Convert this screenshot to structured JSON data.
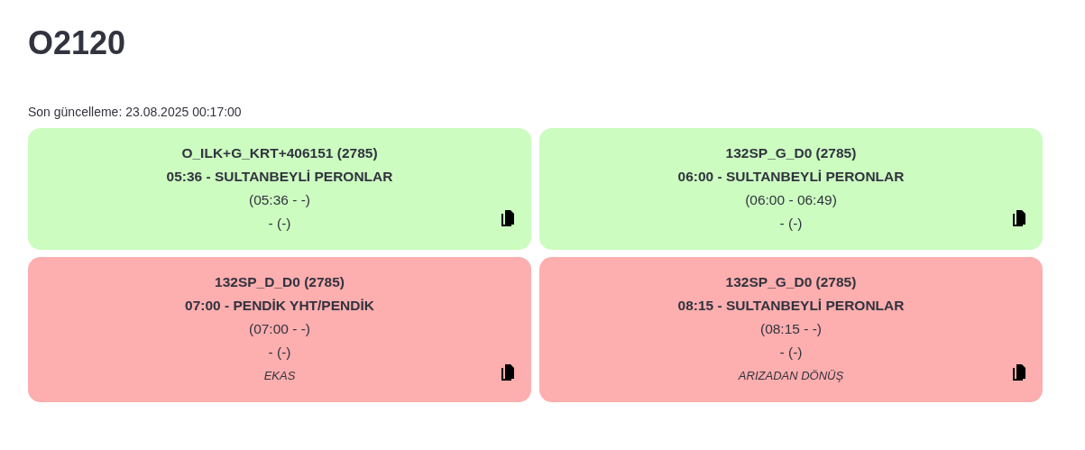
{
  "title": "O2120",
  "last_update": "Son güncelleme: 23.08.2025 00:17:00",
  "cards": [
    {
      "color": "#ccfcc0",
      "code": "O_ILK+G_KRT+406151 (2785)",
      "route": "05:36 - SULTANBEYLİ PERONLAR",
      "times": "(05:36 - -)",
      "extra": "- (-)"
    },
    {
      "color": "#ccfcc0",
      "code": "132SP_G_D0 (2785)",
      "route": "06:00 - SULTANBEYLİ PERONLAR",
      "times": "(06:00 - 06:49)",
      "extra": "- (-)"
    },
    {
      "color": "#fdaeae",
      "code": "132SP_D_D0 (2785)",
      "route": "07:00 - PENDİK YHT/PENDİK",
      "times": "(07:00 - -)",
      "extra": "- (-)",
      "note": "EKAS"
    },
    {
      "color": "#fdaeae",
      "code": "132SP_G_D0 (2785)",
      "route": "08:15 - SULTANBEYLİ PERONLAR",
      "times": "(08:15 - -)",
      "extra": "- (-)",
      "note": "ARIZADAN DÖNÜŞ"
    }
  ]
}
